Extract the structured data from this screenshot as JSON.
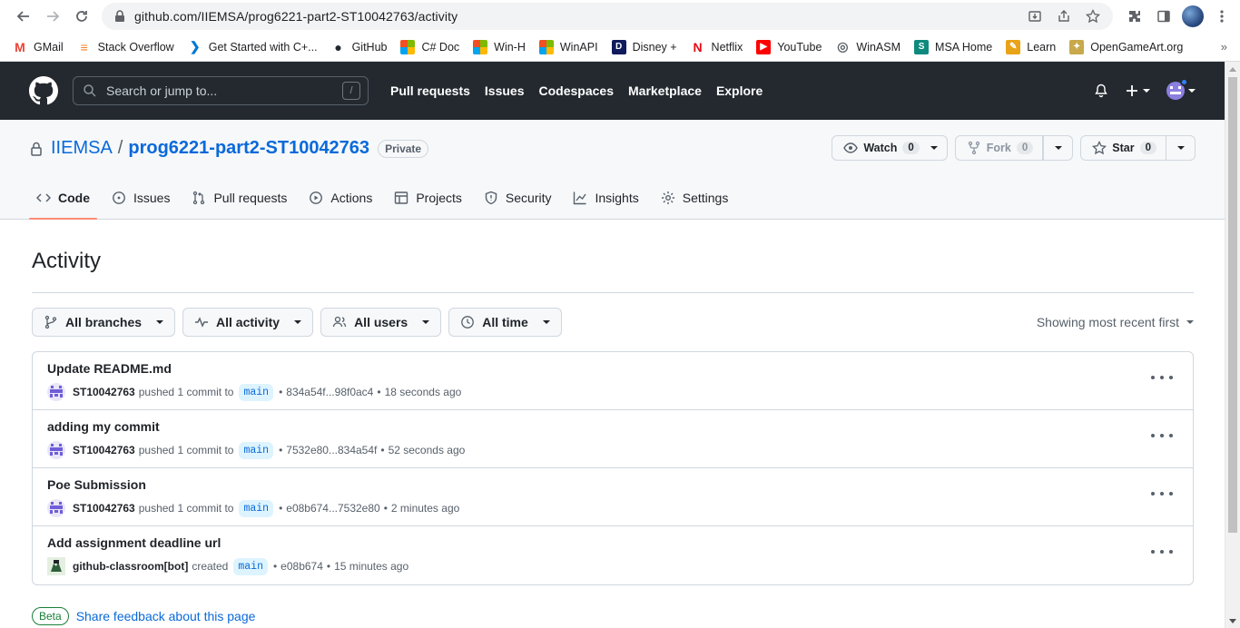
{
  "browser": {
    "url": "github.com/IIEMSA/prog6221-part2-ST10042763/activity",
    "bookmarks": [
      {
        "label": "GMail",
        "icon": "gmail-icon",
        "color": "#ea4335"
      },
      {
        "label": "Stack Overflow",
        "icon": "stackoverflow-icon",
        "color": "#f48024"
      },
      {
        "label": "Get Started with C+...",
        "icon": "vscode-icon",
        "color": "#0078d4"
      },
      {
        "label": "GitHub",
        "icon": "github-icon",
        "color": "#24292f"
      },
      {
        "label": "C# Doc",
        "icon": "microsoft-icon",
        "color": "#f25022"
      },
      {
        "label": "Win-H",
        "icon": "microsoft-icon",
        "color": "#f25022"
      },
      {
        "label": "WinAPI",
        "icon": "microsoft-icon",
        "color": "#f25022"
      },
      {
        "label": "Disney +",
        "icon": "disney-icon",
        "color": "#0f1b5c"
      },
      {
        "label": "Netflix",
        "icon": "netflix-icon",
        "color": "#e50914"
      },
      {
        "label": "YouTube",
        "icon": "youtube-icon",
        "color": "#ff0000"
      },
      {
        "label": "WinASM",
        "icon": "globe-icon",
        "color": "#5f6368"
      },
      {
        "label": "MSA Home",
        "icon": "msa-icon",
        "color": "#0d8a7d"
      },
      {
        "label": "Learn",
        "icon": "learn-icon",
        "color": "#e8a317"
      },
      {
        "label": "OpenGameArt.org",
        "icon": "opengameart-icon",
        "color": "#c8a94b"
      }
    ]
  },
  "header": {
    "search_placeholder": "Search or jump to...",
    "slash_key": "/",
    "nav": [
      "Pull requests",
      "Issues",
      "Codespaces",
      "Marketplace",
      "Explore"
    ]
  },
  "repo": {
    "owner": "IIEMSA",
    "separator": "/",
    "name": "prog6221-part2-ST10042763",
    "visibility": "Private",
    "watch": {
      "label": "Watch",
      "count": "0"
    },
    "fork": {
      "label": "Fork",
      "count": "0"
    },
    "star": {
      "label": "Star",
      "count": "0"
    },
    "tabs": [
      {
        "label": "Code",
        "icon": "code-icon",
        "active": true
      },
      {
        "label": "Issues",
        "icon": "issue-icon"
      },
      {
        "label": "Pull requests",
        "icon": "pull-request-icon"
      },
      {
        "label": "Actions",
        "icon": "play-icon"
      },
      {
        "label": "Projects",
        "icon": "table-icon"
      },
      {
        "label": "Security",
        "icon": "shield-icon"
      },
      {
        "label": "Insights",
        "icon": "graph-icon"
      },
      {
        "label": "Settings",
        "icon": "gear-icon"
      }
    ]
  },
  "activity": {
    "title": "Activity",
    "filters": {
      "branches": "All branches",
      "activity": "All activity",
      "users": "All users",
      "time": "All time"
    },
    "sort": "Showing most recent first",
    "items": [
      {
        "title": "Update README.md",
        "user": "ST10042763",
        "action": "pushed 1 commit to",
        "branch": "main",
        "range": "834a54f...98f0ac4",
        "time": "18 seconds ago",
        "bot": false
      },
      {
        "title": "adding my commit",
        "user": "ST10042763",
        "action": "pushed 1 commit to",
        "branch": "main",
        "range": "7532e80...834a54f",
        "time": "52 seconds ago",
        "bot": false
      },
      {
        "title": "Poe Submission",
        "user": "ST10042763",
        "action": "pushed 1 commit to",
        "branch": "main",
        "range": "e08b674...7532e80",
        "time": "2 minutes ago",
        "bot": false
      },
      {
        "title": "Add assignment deadline url",
        "user": "github-classroom[bot]",
        "action": "created",
        "branch": "main",
        "range": "e08b674",
        "time": "15 minutes ago",
        "bot": true
      }
    ],
    "bullet": "•",
    "beta_label": "Beta",
    "feedback_link": "Share feedback about this page"
  }
}
